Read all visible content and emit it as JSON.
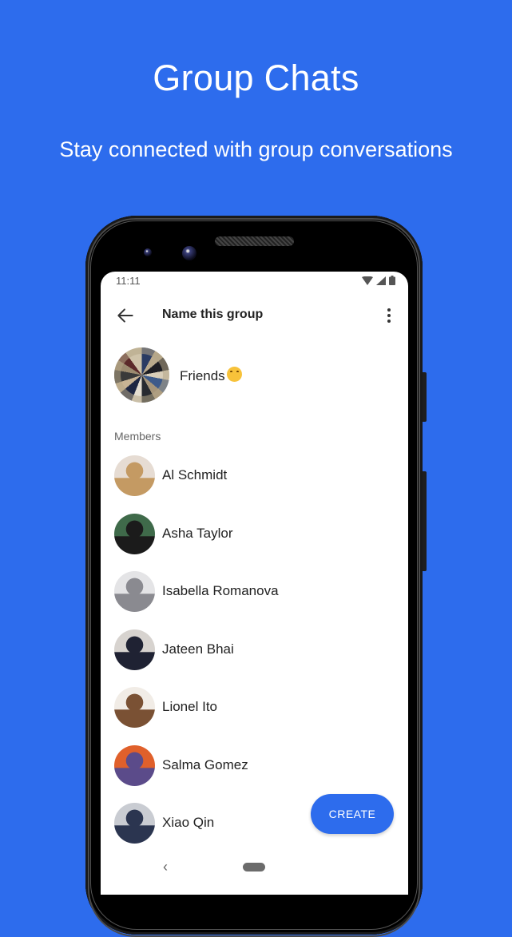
{
  "hero": {
    "title": "Group Chats",
    "subtitle": "Stay connected with group conversations"
  },
  "status_bar": {
    "time": "11:11",
    "icons": [
      "wifi-icon",
      "signal-icon",
      "battery-icon"
    ]
  },
  "app_bar": {
    "back_icon": "arrow-back-icon",
    "title": "Name this group",
    "more_icon": "more-vert-icon"
  },
  "group": {
    "name": "Friends",
    "emoji": "hugging-face-emoji"
  },
  "members": {
    "label": "Members",
    "items": [
      {
        "name": "Al Schmidt",
        "avatar_colors": [
          "#e6dcd3",
          "#c49a63"
        ]
      },
      {
        "name": "Asha Taylor",
        "avatar_colors": [
          "#3f6a4a",
          "#1b1b1b"
        ]
      },
      {
        "name": "Isabella Romanova",
        "avatar_colors": [
          "#e4e4e6",
          "#8a8a90"
        ]
      },
      {
        "name": "Jateen Bhai",
        "avatar_colors": [
          "#d7d3cf",
          "#1f2233"
        ]
      },
      {
        "name": "Lionel Ito",
        "avatar_colors": [
          "#f1ece6",
          "#7a5134"
        ]
      },
      {
        "name": "Salma Gomez",
        "avatar_colors": [
          "#e0602b",
          "#5b4b8a"
        ]
      },
      {
        "name": "Xiao Qin",
        "avatar_colors": [
          "#c9ccd2",
          "#2b3550"
        ]
      }
    ]
  },
  "fab": {
    "label": "CREATE"
  },
  "nav": {
    "back_icon": "nav-back-icon",
    "home_icon": "nav-home-pill"
  },
  "colors": {
    "brand": "#2d6ced",
    "background": "#2d6ced"
  }
}
